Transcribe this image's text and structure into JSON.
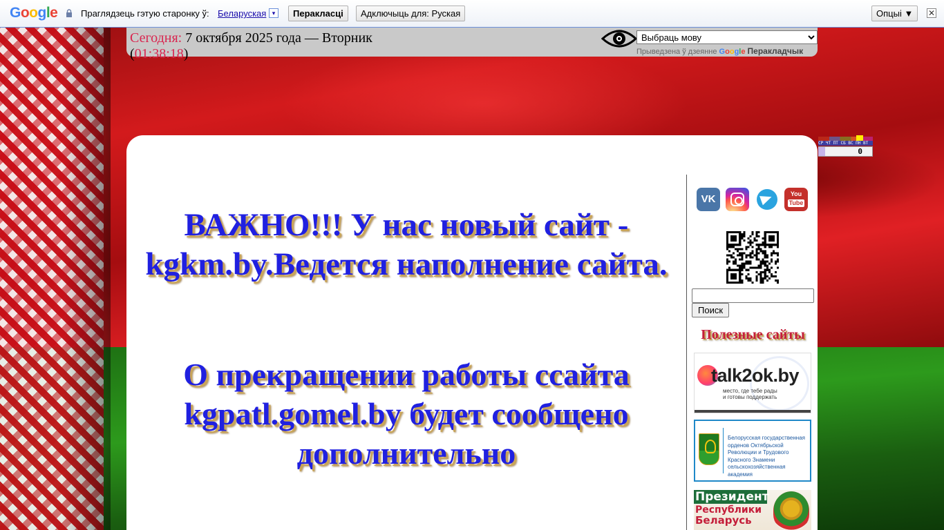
{
  "translate_bar": {
    "logo": "Google",
    "prompt": "Праглядзець гэтую старонку ў:",
    "language": "Беларуская",
    "dropdown_glyph": "▾",
    "translate_button": "Перакласці",
    "disable_button": "Адключыць для: Руская",
    "options_button": "Опцыі ▼",
    "close_glyph": "✕"
  },
  "header": {
    "date_label": "Сегодня:",
    "date_text": " 7 октября 2025 года — Вторник",
    "time_open": "(",
    "time": "01:38:18",
    "time_close": ")",
    "language_select": {
      "selected": "Выбраць мову",
      "options": [
        "Выбраць мову"
      ]
    },
    "powered_by": "Прыведзена ў дзеянне",
    "powered_google": "Google",
    "powered_translator": "Перакладчык"
  },
  "main": {
    "announcement_1": "ВАЖНО!!! У нас новый сайт - kgkm.by.Ведется наполнение сайта.",
    "announcement_2": "О прекращении работы ссайта kgpatl.gomel.by будет сообщено дополнительно"
  },
  "sidebar": {
    "social": [
      {
        "name": "vk-icon",
        "label": "VK"
      },
      {
        "name": "instagram-icon",
        "label": ""
      },
      {
        "name": "telegram-icon",
        "label": ""
      },
      {
        "name": "youtube-icon",
        "label_top": "You",
        "label_bottom": "Tube"
      }
    ],
    "search_value": "",
    "search_button": "Поиск",
    "useful_sites_title": "Полезные сайты",
    "banners": {
      "talk2ok_title": "talk2ok.by",
      "talk2ok_subtitle_1": "место, где тебе рады",
      "talk2ok_subtitle_2": "и готовы поддержать",
      "academy_text": "Белорусская государственная орденов Октябрьской Революции и Трудового Красного Знамени сельскохозяйственная академия",
      "president_line_1": "Президент",
      "president_line_2": "Республики",
      "president_line_3": "Беларусь"
    }
  },
  "counter": {
    "days": "СР ЧТ ПТ СБ ВС ПН ВТ",
    "value": "0"
  },
  "colors": {
    "headline_blue": "#2020e0",
    "accent_red": "#d9254f",
    "useful_title_red": "#c41e3a",
    "translate_link": "#1a0dab"
  }
}
